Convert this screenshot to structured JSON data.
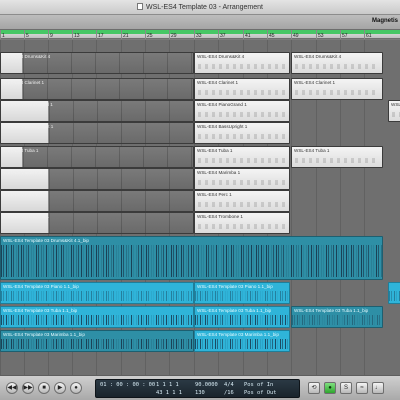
{
  "window": {
    "title": "WSL-ES4 Template 03 - Arrangement"
  },
  "toolbar": {
    "snap_label": "Magnetis"
  },
  "ruler": {
    "bars": [
      "1",
      "5",
      "9",
      "13",
      "17",
      "21",
      "25",
      "29",
      "33",
      "37",
      "41",
      "45",
      "49",
      "53",
      "57",
      "61"
    ]
  },
  "regions": [
    {
      "id": "r1",
      "label": "WSL-ES4 Drums&Kit 4",
      "style": "midi-dark"
    },
    {
      "id": "r2",
      "label": "WSL-ES4 Drums&Kit 4",
      "style": "midi-light"
    },
    {
      "id": "r3",
      "label": "WSL-ES4 Drums&Kit 4",
      "style": "midi-light"
    },
    {
      "id": "r4",
      "label": "WSL-ES4 Clarinet 1",
      "style": "midi-dark"
    },
    {
      "id": "r5",
      "label": "WSL-ES4 Clarinet 1",
      "style": "midi-light"
    },
    {
      "id": "r6",
      "label": "WSL-ES4 Clarinet 1",
      "style": "midi-light"
    },
    {
      "id": "r7",
      "label": "WSL-ES4 PianoGrand 1",
      "style": "midi-dark"
    },
    {
      "id": "r8",
      "label": "WSL-ES4 PianoGrand 1",
      "style": "midi-light"
    },
    {
      "id": "r9",
      "label": "WSL-ES4 PianoGr",
      "style": "midi-light"
    },
    {
      "id": "r10",
      "label": "WSL-ES4 BassUpright 1",
      "style": "midi-dark"
    },
    {
      "id": "r11",
      "label": "WSL-ES4 BassUpright 1",
      "style": "midi-light"
    },
    {
      "id": "r12",
      "label": "WSL-ES4 Tuba 1",
      "style": "midi-dark"
    },
    {
      "id": "r13",
      "label": "WSL-ES4 Tuba 1",
      "style": "midi-light"
    },
    {
      "id": "r14",
      "label": "WSL-ES4 Tuba 1",
      "style": "midi-light"
    },
    {
      "id": "r15",
      "label": "WSL-ES4 Marimba 1",
      "style": "midi-dark"
    },
    {
      "id": "r16",
      "label": "WSL-ES4 Marimba 1",
      "style": "midi-light"
    },
    {
      "id": "r17",
      "label": "WSL-ES4 Perc 1",
      "style": "midi-dark"
    },
    {
      "id": "r18",
      "label": "WSL-ES4 Perc 1",
      "style": "midi-light"
    },
    {
      "id": "r19",
      "label": "WSL-ES4 Trombone 1",
      "style": "midi-dark"
    },
    {
      "id": "r20",
      "label": "WSL-ES4 Trombone 1",
      "style": "midi-light"
    },
    {
      "id": "a1",
      "label": "WSL-ES4 Template 03 Drums&Kit 4.1_bip",
      "style": "audio"
    },
    {
      "id": "a2",
      "label": "WSL-ES4 Template 03 Piano 1.1_bip",
      "style": "audio"
    },
    {
      "id": "a3",
      "label": "WSL-ES4 Template 03 Piano 1.1_bip",
      "style": "audio"
    },
    {
      "id": "a4",
      "label": "WSL-ES4 Template 03 Piano 1.1_bip",
      "style": "audio"
    },
    {
      "id": "a5",
      "label": "WSL-ES4 Template 03 Tuba 1.1_bip",
      "style": "audio"
    },
    {
      "id": "a6",
      "label": "WSL-ES4 Template 03 Tuba 1.1_bip",
      "style": "audio"
    },
    {
      "id": "a7",
      "label": "WSL-ES4 Template 03 Tuba 1.1_bip",
      "style": "audio"
    },
    {
      "id": "a8",
      "label": "WSL-ES4 Template 03 Marimba 1.1_bip",
      "style": "audio"
    },
    {
      "id": "a9",
      "label": "WSL-ES4 Template 03 Marimba 1.1_bip",
      "style": "audio"
    }
  ],
  "transport": {
    "buttons": [
      "rewind",
      "fast-forward",
      "stop",
      "play",
      "record"
    ],
    "time": "01 : 00 : 00 : 00",
    "position": "1    1    1    1",
    "tempo": "90.0000",
    "signature": "4/4",
    "punch_in": "Pos of In",
    "row2_bars": "43    1    1    1",
    "row2_value": "130",
    "row2_division": "/16",
    "punch_out": "Pos of Out",
    "right_buttons": [
      "cycle",
      "replace",
      "solo",
      "sync",
      "metronome"
    ]
  },
  "colors": {
    "audio": "#2e8fa6",
    "audio_bright": "#2fb4d9",
    "cycle": "#46c765",
    "lcd": "#1a242c"
  }
}
